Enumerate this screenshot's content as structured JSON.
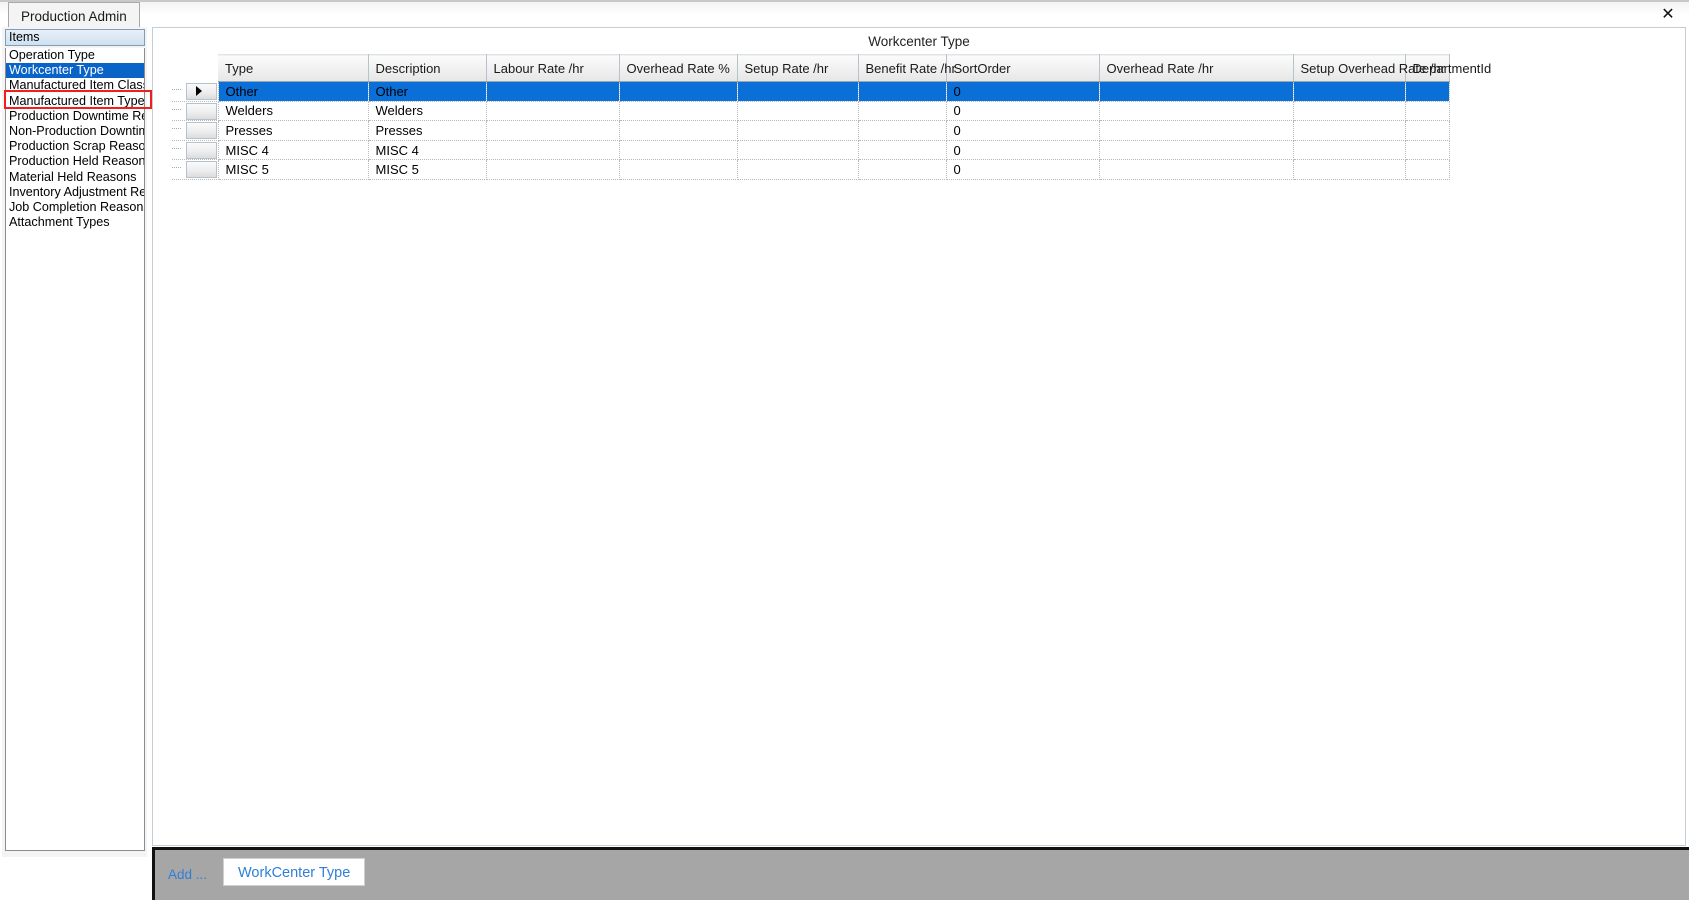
{
  "window": {
    "tab_label": "Production Admin",
    "close_icon": "close-icon",
    "close_glyph": "✕"
  },
  "sidebar": {
    "header": "Items",
    "items": [
      {
        "label": "Operation Type",
        "selected": false
      },
      {
        "label": "Workcenter Type",
        "selected": true
      },
      {
        "label": "Manufactured Item Class",
        "selected": false
      },
      {
        "label": "Manufactured Item Type",
        "selected": false
      },
      {
        "label": "Production Downtime Re",
        "selected": false
      },
      {
        "label": "Non-Production Downtim",
        "selected": false
      },
      {
        "label": "Production Scrap Reason",
        "selected": false
      },
      {
        "label": "Production Held Reasons",
        "selected": false
      },
      {
        "label": "Material Held Reasons",
        "selected": false
      },
      {
        "label": "Inventory Adjustment Re",
        "selected": false
      },
      {
        "label": "Job Completion Reasons",
        "selected": false
      },
      {
        "label": "Attachment Types",
        "selected": false
      }
    ]
  },
  "main": {
    "caption": "Workcenter Type",
    "grid": {
      "columns": [
        "Type",
        "Description",
        "Labour Rate /hr",
        "Overhead  Rate %",
        "Setup Rate /hr",
        "Benefit Rate /hr",
        "SortOrder",
        "Overhead  Rate /hr",
        "Setup Overhead  Rate /hr",
        "DepartmentId"
      ],
      "rows": [
        {
          "selected": true,
          "cells": [
            "Other",
            "Other",
            "",
            "",
            "",
            "",
            "0",
            "",
            "",
            ""
          ]
        },
        {
          "selected": false,
          "cells": [
            "Welders",
            "Welders",
            "",
            "",
            "",
            "",
            "0",
            "",
            "",
            ""
          ]
        },
        {
          "selected": false,
          "cells": [
            "Presses",
            "Presses",
            "",
            "",
            "",
            "",
            "0",
            "",
            "",
            ""
          ]
        },
        {
          "selected": false,
          "cells": [
            "MISC 4",
            "MISC 4",
            "",
            "",
            "",
            "",
            "0",
            "",
            "",
            ""
          ]
        },
        {
          "selected": false,
          "cells": [
            "MISC 5",
            "MISC 5",
            "",
            "",
            "",
            "",
            "0",
            "",
            "",
            ""
          ]
        }
      ]
    }
  },
  "bottom_bar": {
    "add_label": "Add ...",
    "workcenter_type_button": "WorkCenter Type"
  },
  "colors": {
    "selection_blue": "#0a6fd6",
    "sidebar_selection_blue": "#0a64c8",
    "annotation_red": "#f01e1e",
    "link_blue": "#2f7fd8",
    "toolbar_gray": "#a6a6a6"
  }
}
